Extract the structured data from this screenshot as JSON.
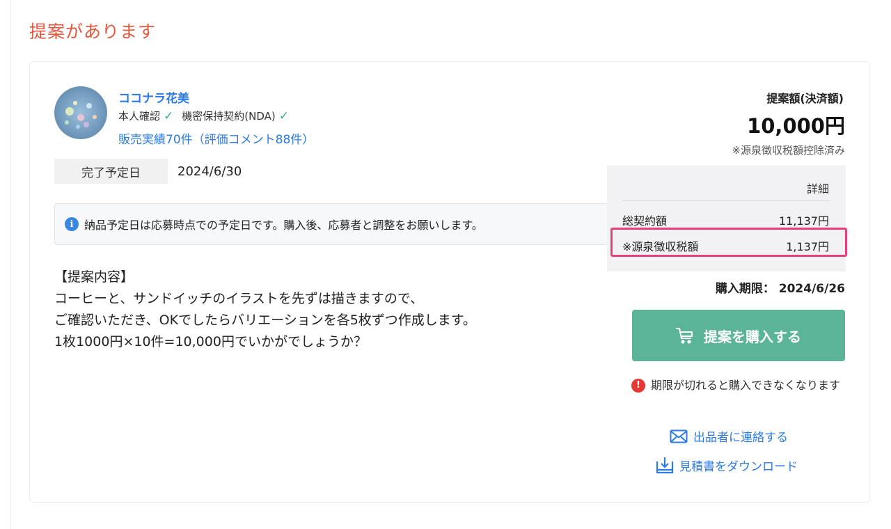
{
  "page": {
    "title": "提案があります"
  },
  "seller": {
    "name": "ココナラ花美",
    "identity_label": "本人確認",
    "nda_label": "機密保持契約(NDA)",
    "sales_record": "販売実績70件（評価コメント88件）"
  },
  "schedule": {
    "label": "完了予定日",
    "date": "2024/6/30"
  },
  "notice": {
    "text": "納品予定日は応募時点での予定日です。購入後、応募者と調整をお願いします。"
  },
  "proposal": {
    "lines": [
      "【提案内容】",
      "コーヒーと、サンドイッチのイラストを先ずは描きますので、",
      "ご確認いただき、OKでしたらバリエーションを各5枚ずつ作成します。",
      "1枚1000円×10件=10,000円でいかがでしょうか？"
    ]
  },
  "pricing": {
    "label": "提案額(決済額)",
    "amount": "10,000円",
    "note": "※源泉徴収税額控除済み",
    "detail_label": "詳細",
    "rows": [
      {
        "label": "総契約額",
        "value": "11,137円"
      },
      {
        "label": "※源泉徴収税額",
        "value": "1,137円"
      }
    ],
    "highlight_color": "#e8417a"
  },
  "purchase": {
    "deadline": "購入期限： 2024/6/26",
    "button_label": "提案を購入する",
    "button_color": "#5cb498",
    "warning": "期限が切れると購入できなくなります"
  },
  "links": {
    "contact": "出品者に連絡する",
    "download": "見積書をダウンロード"
  },
  "colors": {
    "accent_title": "#e4573d",
    "link": "#2c7be5"
  }
}
